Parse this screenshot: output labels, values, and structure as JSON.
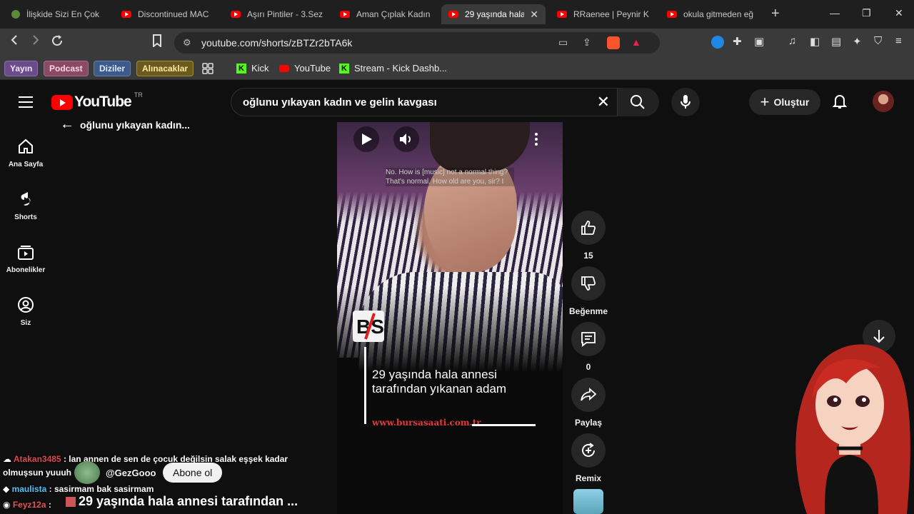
{
  "browser": {
    "tabs": [
      {
        "title": "İlişkide Sizi En Çok",
        "active": false
      },
      {
        "title": "Discontinued MAC",
        "active": false
      },
      {
        "title": "Aşırı Pintiler - 3.Sez",
        "active": false
      },
      {
        "title": "Aman Çıplak Kadın",
        "active": false
      },
      {
        "title": "29 yaşında hala",
        "active": true
      },
      {
        "title": "RRaenee | Peynir K",
        "active": false
      },
      {
        "title": "okula gitmeden eğ",
        "active": false
      }
    ],
    "url": "youtube.com/shorts/zBTZr2bTA6k",
    "bookmark_tags": [
      "Yayın",
      "Podcast",
      "Diziler",
      "Alınacaklar"
    ],
    "bookmarks": [
      "Kick",
      "YouTube",
      "Stream - Kick Dashb..."
    ]
  },
  "youtube": {
    "logo_text": "YouTube",
    "country": "TR",
    "back_label": "oğlunu yıkayan kadın...",
    "search_query": "oğlunu yıkayan kadın ve gelin kavgası",
    "create_label": "Oluştur",
    "sidebar": [
      {
        "label": "Ana Sayfa",
        "icon": "home-icon"
      },
      {
        "label": "Shorts",
        "icon": "shorts-icon"
      },
      {
        "label": "Abonelikler",
        "icon": "subscriptions-icon"
      },
      {
        "label": "Siz",
        "icon": "you-icon"
      }
    ]
  },
  "video": {
    "caption_line1": "No.  How is [music] not a normal thing?",
    "caption_line2": "That's normal.  How old are you, sir?   I",
    "title_line1": "29 yaşında hala annesi",
    "title_line2": "tarafından yıkanan adam",
    "site": "www.bursasaati.com.tr"
  },
  "actions": {
    "likes": "15",
    "dislike_label": "Beğenme",
    "comments": "0",
    "share_label": "Paylaş",
    "remix_label": "Remix"
  },
  "chat": {
    "msg1_user": "Atakan3485",
    "msg1_text": ": lan annen de sen de çocuk değilsin salak eşşek kadar",
    "msg1_text2": "olmuşsun yuuuh",
    "channel_handle": "@GezGooo",
    "subscribe_label": "Abone ol",
    "msg2_user": "maulista",
    "msg2_text": ": sasirmam bak sasirmam",
    "msg3_user": "Feyz12a",
    "msg3_text": "29 yaşında hala annesi tarafından ..."
  }
}
